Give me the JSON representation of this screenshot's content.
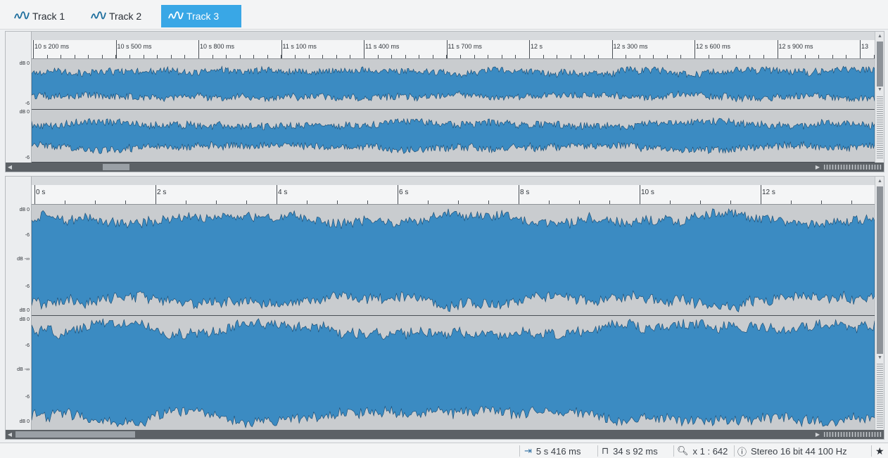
{
  "tabs": [
    {
      "label": "Track 1",
      "icon": "waveform-icon",
      "active": false
    },
    {
      "label": "Track 2",
      "icon": "waveform-icon",
      "active": false
    },
    {
      "label": "Track 3",
      "icon": "waveform-icon",
      "active": true
    }
  ],
  "top_view": {
    "ruler_labels": [
      "10 s 200 ms",
      "10 s 500 ms",
      "10 s 800 ms",
      "11 s 100 ms",
      "11 s 400 ms",
      "11 s 700 ms",
      "12 s",
      "12 s 300 ms",
      "12 s 600 ms",
      "12 s 900 ms",
      "13"
    ],
    "channel_db_top": "dB 0",
    "channel_db_bottom": "-6"
  },
  "bottom_view": {
    "ruler_labels": [
      "0 s",
      "2 s",
      "4 s",
      "6 s",
      "8 s",
      "10 s",
      "12 s"
    ],
    "db_labels": {
      "top": "dB 0",
      "upper": "-6",
      "middle": "dB -∞",
      "lower": "-6",
      "bottom": "dB 0"
    }
  },
  "statusbar": {
    "cursor_position": "5 s 416 ms",
    "selection_length": "34 s 92 ms",
    "zoom": "x 1 : 642",
    "format": "Stereo 16 bit 44 100 Hz"
  },
  "colors": {
    "accent": "#39a7e6",
    "waveform_fill": "#3b8bc2",
    "waveform_outline": "#16476e",
    "channel_bg": "#c9cccf"
  }
}
